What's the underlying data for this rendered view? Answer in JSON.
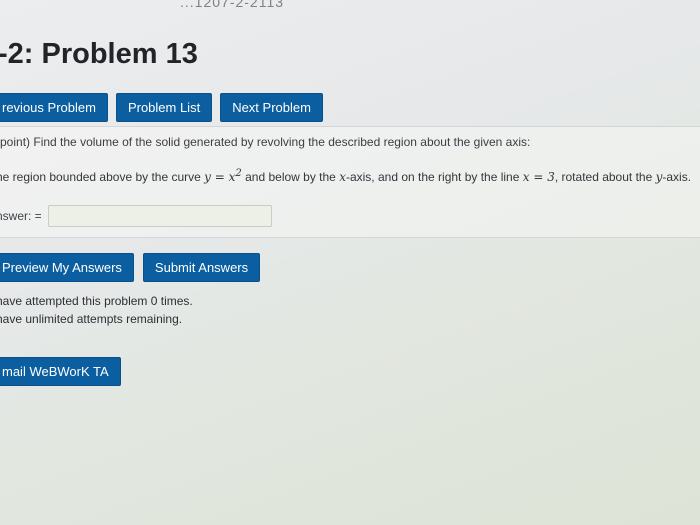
{
  "header": {
    "top_crumb": "...1207-2-2113",
    "title": "-2: Problem 13"
  },
  "nav": {
    "previous": "revious Problem",
    "list": "Problem List",
    "next": "Next Problem"
  },
  "problem": {
    "points": "point)",
    "prompt": "Find the volume of the solid generated by revolving the described region about the given axis:",
    "region_text_start": "he region bounded above by the curve ",
    "curve": "y = x",
    "exponent": "2",
    "region_text_mid": " and below by the ",
    "axis_var": "x",
    "region_text_mid2": "-axis, and on the right by the line ",
    "line_eq": "x = 3",
    "region_text_end": ", rotated about the ",
    "rot_axis": "y",
    "region_text_tail": "-axis."
  },
  "answer": {
    "label": "nswer: =",
    "value": ""
  },
  "actions": {
    "preview": "Preview My Answers",
    "submit": "Submit Answers"
  },
  "attempts": {
    "line1": "have attempted this problem 0 times.",
    "line2": "have unlimited attempts remaining."
  },
  "email": {
    "label": "mail WeBWorK TA"
  }
}
